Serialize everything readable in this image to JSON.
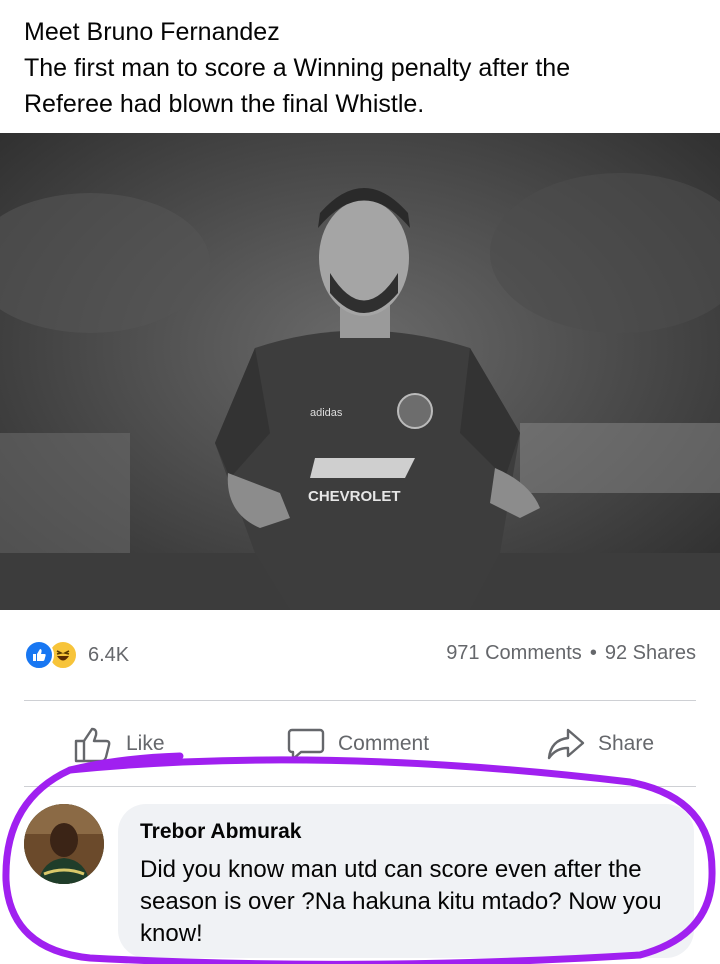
{
  "post": {
    "text_lines": [
      "Meet Bruno Fernandez",
      "The first man to score a Winning penalty after the",
      "Referee had blown the final Whistle."
    ],
    "image": {
      "jersey_sponsor": "CHEVROLET",
      "jersey_brand": "adidas"
    }
  },
  "stats": {
    "reaction_icons": [
      "like-icon",
      "haha-icon"
    ],
    "reaction_count": "6.4K",
    "comments": "971 Comments",
    "separator": "•",
    "shares": "92 Shares"
  },
  "actions": {
    "like_label": "Like",
    "comment_label": "Comment",
    "share_label": "Share"
  },
  "comment": {
    "author": "Trebor Abmurak",
    "text": "Did you know man utd can score even after the season is over ?Na hakuna kitu mtado? Now you know!"
  },
  "colors": {
    "like_blue": "#1877f2",
    "haha_yellow": "#f7c43a",
    "secondary_text": "#65676b",
    "bubble_bg": "#f0f2f5",
    "highlight_purple": "#a020f0"
  }
}
